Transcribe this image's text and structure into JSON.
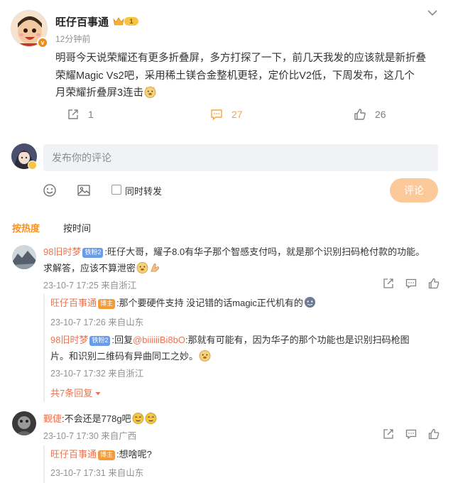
{
  "post": {
    "author": "旺仔百事通",
    "level_badge": "1",
    "time": "12分钟前",
    "text_line1": "明哥今天说荣耀还有更多折叠屏，多方打探了一下，前几天我发的应该就是新折叠",
    "text_line2": "荣耀Magic Vs2吧，采用稀土镁合金整机更轻，定价比V2低，下周发布，这几个",
    "text_line3": "月荣耀折叠屏3连击",
    "repost_count": "1",
    "comment_count": "27",
    "like_count": "26"
  },
  "composer": {
    "placeholder": "发布你的评论",
    "repost_label": "同时转发",
    "submit_label": "评论"
  },
  "sort_tabs": {
    "hot": "按热度",
    "time": "按时间"
  },
  "comments": [
    {
      "user": "98旧时梦",
      "badge": "铁粉2",
      "text_line1": ":旺仔大哥，耀子8.0有华子那个智感支付吗，就是那个识别扫码枪付款的功能。",
      "text_line2": "求解答，应该不算泄密",
      "time": "23-10-7 17:25 来自浙江",
      "replies": [
        {
          "user": "旺仔百事通",
          "badge": "博主",
          "text": ":那个要硬件支持 没记错的话magic正代机有的",
          "time": "23-10-7 17:26 来自山东"
        },
        {
          "user": "98旧时梦",
          "badge": "铁粉2",
          "prefix": ":回复",
          "mention": "@biiiiiiBi8bO",
          "text_line1": ":那就有可能有，因为华子的那个功能也是识别扫码枪图",
          "text_line2": "片。和识别二维码有异曲同工之妙。",
          "time": "23-10-7 17:32 来自浙江"
        }
      ],
      "more_replies": "共7条回复"
    },
    {
      "user": "觐倢",
      "text": ":不会还是778g吧",
      "time": "23-10-7 17:30 来自广西",
      "replies": [
        {
          "user": "旺仔百事通",
          "badge": "博主",
          "text": ":想啥呢?",
          "time": "23-10-7 17:31 来自山东"
        }
      ]
    }
  ],
  "colors": {
    "accent_orange": "#f7931e",
    "username": "#eb7350",
    "submit_disabled": "#fcc99a"
  },
  "icons": [
    "chevron-down-icon",
    "repost-icon",
    "comment-icon",
    "like-icon",
    "emoji-icon",
    "image-icon",
    "share-icon",
    "reply-icon",
    "crown-icon",
    "vip-badge-icon"
  ]
}
